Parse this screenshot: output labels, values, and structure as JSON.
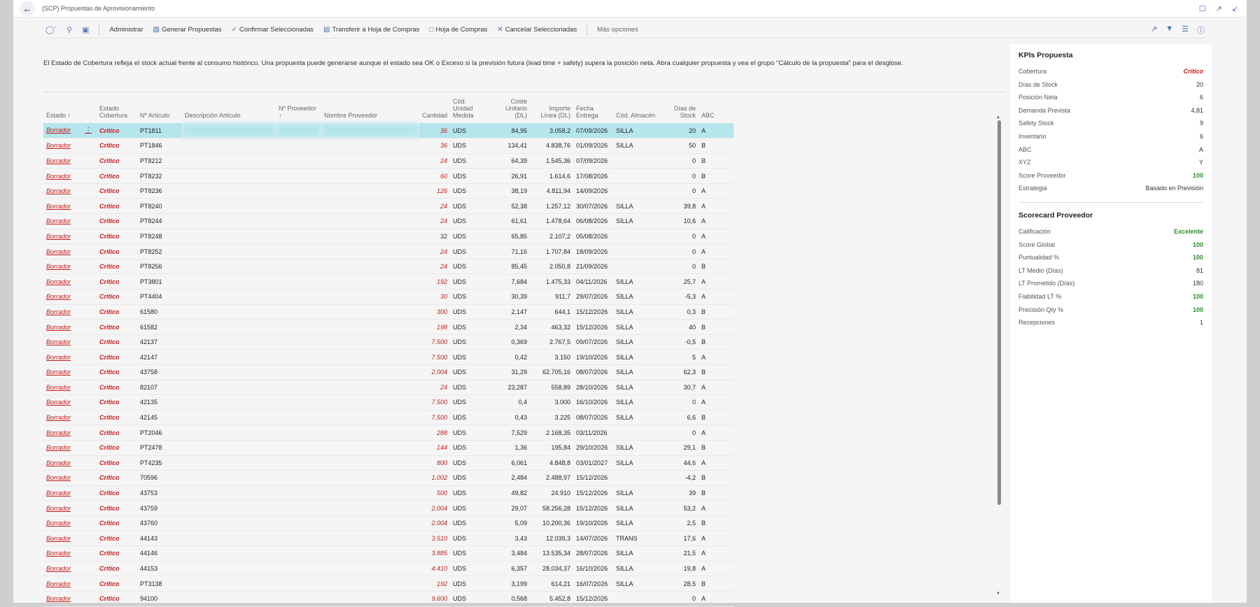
{
  "window": {
    "title": "(SCP) Propuestas de Aprovisionamiento"
  },
  "toolbar": {
    "items": [
      {
        "label": "Administrar",
        "icon": ""
      },
      {
        "label": "Generar Propuestas",
        "icon": "generate-icon"
      },
      {
        "label": "Confirmar Seleccionadas",
        "icon": "check-icon"
      },
      {
        "label": "Transferir a Hoja de Compras",
        "icon": "transfer-icon"
      },
      {
        "label": "Hoja de Compras",
        "icon": "document-icon"
      },
      {
        "label": "Cancelar Seleccionadas",
        "icon": "close-icon"
      }
    ],
    "more": "Más opciones"
  },
  "info_text": "El Estado de Cobertura refleja el stock actual frente al consumo histórico. Una propuesta puede generarse aunque el estado sea OK o Exceso si la previsión futura (lead time + safety) supera la posición neta. Abra cualquier propuesta y vea el grupo \"Cálculo de la propuesta\" para el desglose.",
  "columns": {
    "estado": "Estado ↑",
    "cobertura": "Estado Cobertura",
    "articulo": "Nº Artículo",
    "descripcion": "Descripción Artículo",
    "proveedor": "Nº Proveedor ↑",
    "nombre": "Nombre Proveedor",
    "cantidad": "Cantidad",
    "unidad": "Cód. Unidad Medida",
    "coste": "Coste Unitario (DL)",
    "importe": "Importe Línea (DL)",
    "fecha": "Fecha Entrega",
    "almacen": "Cód. Almacén",
    "dias": "Días de Stock",
    "abc": "ABC"
  },
  "rows": [
    {
      "estado": "Borrador",
      "cob": "Crítico",
      "art": "PT1811",
      "qty": "36",
      "red": true,
      "ud": "UDS",
      "coste": "84,95",
      "imp": "3.058,2",
      "fecha": "07/09/2026",
      "alm": "SILLA",
      "dias": "20",
      "abc": "A"
    },
    {
      "estado": "Borrador",
      "cob": "Crítico",
      "art": "PT1846",
      "qty": "36",
      "red": true,
      "ud": "UDS",
      "coste": "134,41",
      "imp": "4.838,76",
      "fecha": "01/09/2026",
      "alm": "SILLA",
      "dias": "50",
      "abc": "B"
    },
    {
      "estado": "Borrador",
      "cob": "Crítico",
      "art": "PT8212",
      "qty": "24",
      "red": true,
      "ud": "UDS",
      "coste": "64,39",
      "imp": "1.545,36",
      "fecha": "07/09/2026",
      "alm": "",
      "dias": "0",
      "abc": "B"
    },
    {
      "estado": "Borrador",
      "cob": "Crítico",
      "art": "PT8232",
      "qty": "60",
      "red": true,
      "ud": "UDS",
      "coste": "26,91",
      "imp": "1.614,6",
      "fecha": "17/08/2026",
      "alm": "",
      "dias": "0",
      "abc": "B"
    },
    {
      "estado": "Borrador",
      "cob": "Crítico",
      "art": "PT8236",
      "qty": "126",
      "red": true,
      "ud": "UDS",
      "coste": "38,19",
      "imp": "4.811,94",
      "fecha": "14/09/2026",
      "alm": "",
      "dias": "0",
      "abc": "A"
    },
    {
      "estado": "Borrador",
      "cob": "Crítico",
      "art": "PT8240",
      "qty": "24",
      "red": true,
      "ud": "UDS",
      "coste": "52,38",
      "imp": "1.257,12",
      "fecha": "30/07/2026",
      "alm": "SILLA",
      "dias": "39,8",
      "abc": "A"
    },
    {
      "estado": "Borrador",
      "cob": "Crítico",
      "art": "PT8244",
      "qty": "24",
      "red": true,
      "ud": "UDS",
      "coste": "61,61",
      "imp": "1.478,64",
      "fecha": "06/08/2026",
      "alm": "SILLA",
      "dias": "10,6",
      "abc": "A"
    },
    {
      "estado": "Borrador",
      "cob": "Crítico",
      "art": "PT8248",
      "qty": "32",
      "red": false,
      "ud": "UDS",
      "coste": "65,85",
      "imp": "2.107,2",
      "fecha": "05/08/2026",
      "alm": "",
      "dias": "0",
      "abc": "A"
    },
    {
      "estado": "Borrador",
      "cob": "Crítico",
      "art": "PT8252",
      "qty": "24",
      "red": true,
      "ud": "UDS",
      "coste": "71,16",
      "imp": "1.707,84",
      "fecha": "18/09/2026",
      "alm": "",
      "dias": "0",
      "abc": "A"
    },
    {
      "estado": "Borrador",
      "cob": "Crítico",
      "art": "PT8256",
      "qty": "24",
      "red": true,
      "ud": "UDS",
      "coste": "85,45",
      "imp": "2.050,8",
      "fecha": "21/09/2026",
      "alm": "",
      "dias": "0",
      "abc": "B"
    },
    {
      "estado": "Borrador",
      "cob": "Crítico",
      "art": "PT3801",
      "qty": "192",
      "red": true,
      "ud": "UDS",
      "coste": "7,684",
      "imp": "1.475,33",
      "fecha": "04/11/2026",
      "alm": "SILLA",
      "dias": "25,7",
      "abc": "A"
    },
    {
      "estado": "Borrador",
      "cob": "Crítico",
      "art": "PT4404",
      "qty": "30",
      "red": true,
      "ud": "UDS",
      "coste": "30,39",
      "imp": "911,7",
      "fecha": "29/07/2026",
      "alm": "SILLA",
      "dias": "-5,3",
      "abc": "A"
    },
    {
      "estado": "Borrador",
      "cob": "Crítico",
      "art": "61580",
      "qty": "300",
      "red": true,
      "ud": "UDS",
      "coste": "2,147",
      "imp": "644,1",
      "fecha": "15/12/2026",
      "alm": "SILLA",
      "dias": "0,3",
      "abc": "B"
    },
    {
      "estado": "Borrador",
      "cob": "Crítico",
      "art": "61582",
      "qty": "198",
      "red": true,
      "ud": "UDS",
      "coste": "2,34",
      "imp": "463,32",
      "fecha": "15/12/2026",
      "alm": "SILLA",
      "dias": "40",
      "abc": "B"
    },
    {
      "estado": "Borrador",
      "cob": "Crítico",
      "art": "42137",
      "qty": "7.500",
      "red": true,
      "ud": "UDS",
      "coste": "0,369",
      "imp": "2.767,5",
      "fecha": "09/07/2026",
      "alm": "SILLA",
      "dias": "-0,5",
      "abc": "B"
    },
    {
      "estado": "Borrador",
      "cob": "Crítico",
      "art": "42147",
      "qty": "7.500",
      "red": true,
      "ud": "UDS",
      "coste": "0,42",
      "imp": "3.150",
      "fecha": "19/10/2026",
      "alm": "SILLA",
      "dias": "5",
      "abc": "A"
    },
    {
      "estado": "Borrador",
      "cob": "Crítico",
      "art": "43758",
      "qty": "2.004",
      "red": true,
      "ud": "UDS",
      "coste": "31,29",
      "imp": "62.705,16",
      "fecha": "08/07/2026",
      "alm": "SILLA",
      "dias": "62,3",
      "abc": "B"
    },
    {
      "estado": "Borrador",
      "cob": "Crítico",
      "art": "82107",
      "qty": "24",
      "red": true,
      "ud": "UDS",
      "coste": "23,287",
      "imp": "558,89",
      "fecha": "28/10/2026",
      "alm": "SILLA",
      "dias": "30,7",
      "abc": "A"
    },
    {
      "estado": "Borrador",
      "cob": "Crítico",
      "art": "42135",
      "qty": "7.500",
      "red": true,
      "ud": "UDS",
      "coste": "0,4",
      "imp": "3.000",
      "fecha": "16/10/2026",
      "alm": "SILLA",
      "dias": "0",
      "abc": "A"
    },
    {
      "estado": "Borrador",
      "cob": "Crítico",
      "art": "42145",
      "qty": "7.500",
      "red": true,
      "ud": "UDS",
      "coste": "0,43",
      "imp": "3.225",
      "fecha": "08/07/2026",
      "alm": "SILLA",
      "dias": "6,6",
      "abc": "B"
    },
    {
      "estado": "Borrador",
      "cob": "Crítico",
      "art": "PT2046",
      "qty": "288",
      "red": true,
      "ud": "UDS",
      "coste": "7,529",
      "imp": "2.168,35",
      "fecha": "03/11/2026",
      "alm": "",
      "dias": "0",
      "abc": "A"
    },
    {
      "estado": "Borrador",
      "cob": "Crítico",
      "art": "PT2478",
      "qty": "144",
      "red": true,
      "ud": "UDS",
      "coste": "1,36",
      "imp": "195,84",
      "fecha": "29/10/2026",
      "alm": "SILLA",
      "dias": "29,1",
      "abc": "B"
    },
    {
      "estado": "Borrador",
      "cob": "Crítico",
      "art": "PT4235",
      "qty": "800",
      "red": true,
      "ud": "UDS",
      "coste": "6,061",
      "imp": "4.848,8",
      "fecha": "03/01/2027",
      "alm": "SILLA",
      "dias": "44,6",
      "abc": "A"
    },
    {
      "estado": "Borrador",
      "cob": "Crítico",
      "art": "70596",
      "qty": "1.002",
      "red": true,
      "ud": "UDS",
      "coste": "2,484",
      "imp": "2.488,97",
      "fecha": "15/12/2026",
      "alm": "",
      "dias": "-4,2",
      "abc": "B"
    },
    {
      "estado": "Borrador",
      "cob": "Crítico",
      "art": "43753",
      "qty": "500",
      "red": true,
      "ud": "UDS",
      "coste": "49,82",
      "imp": "24.910",
      "fecha": "15/12/2026",
      "alm": "SILLA",
      "dias": "39",
      "abc": "B"
    },
    {
      "estado": "Borrador",
      "cob": "Crítico",
      "art": "43759",
      "qty": "2.004",
      "red": true,
      "ud": "UDS",
      "coste": "29,07",
      "imp": "58.256,28",
      "fecha": "15/12/2026",
      "alm": "SILLA",
      "dias": "53,2",
      "abc": "A"
    },
    {
      "estado": "Borrador",
      "cob": "Crítico",
      "art": "43760",
      "qty": "2.004",
      "red": true,
      "ud": "UDS",
      "coste": "5,09",
      "imp": "10.200,36",
      "fecha": "19/10/2026",
      "alm": "SILLA",
      "dias": "2,5",
      "abc": "B"
    },
    {
      "estado": "Borrador",
      "cob": "Crítico",
      "art": "44143",
      "qty": "3.510",
      "red": true,
      "ud": "UDS",
      "coste": "3,43",
      "imp": "12.039,3",
      "fecha": "14/07/2026",
      "alm": "TRANS",
      "dias": "17,6",
      "abc": "A"
    },
    {
      "estado": "Borrador",
      "cob": "Crítico",
      "art": "44146",
      "qty": "3.885",
      "red": true,
      "ud": "UDS",
      "coste": "3,484",
      "imp": "13.535,34",
      "fecha": "28/07/2026",
      "alm": "SILLA",
      "dias": "21,5",
      "abc": "A"
    },
    {
      "estado": "Borrador",
      "cob": "Crítico",
      "art": "44153",
      "qty": "4.410",
      "red": true,
      "ud": "UDS",
      "coste": "6,357",
      "imp": "28.034,37",
      "fecha": "16/10/2026",
      "alm": "SILLA",
      "dias": "19,8",
      "abc": "A"
    },
    {
      "estado": "Borrador",
      "cob": "Crítico",
      "art": "PT3138",
      "qty": "192",
      "red": true,
      "ud": "UDS",
      "coste": "3,199",
      "imp": "614,21",
      "fecha": "16/07/2026",
      "alm": "SILLA",
      "dias": "28,5",
      "abc": "B"
    },
    {
      "estado": "Borrador",
      "cob": "Crítico",
      "art": "94100",
      "qty": "9.600",
      "red": true,
      "ud": "UDS",
      "coste": "0,568",
      "imp": "5.452,8",
      "fecha": "15/12/2026",
      "alm": "",
      "dias": "0",
      "abc": "A"
    }
  ],
  "kpis": {
    "title": "KPIs Propuesta",
    "items": [
      {
        "label": "Cobertura",
        "value": "Crítico",
        "style": "crit"
      },
      {
        "label": "Días de Stock",
        "value": "20",
        "style": ""
      },
      {
        "label": "Posición Neta",
        "value": "6",
        "style": ""
      },
      {
        "label": "Demanda Prevista",
        "value": "4,81",
        "style": ""
      },
      {
        "label": "Safety Stock",
        "value": "9",
        "style": ""
      },
      {
        "label": "Inventario",
        "value": "6",
        "style": ""
      },
      {
        "label": "ABC",
        "value": "A",
        "style": ""
      },
      {
        "label": "XYZ",
        "value": "Y",
        "style": ""
      },
      {
        "label": "Score Proveedor",
        "value": "100",
        "style": "good"
      },
      {
        "label": "Estrategia",
        "value": "Basado en Previsión",
        "style": ""
      }
    ]
  },
  "scorecard": {
    "title": "Scorecard Proveedor",
    "items": [
      {
        "label": "Calificación",
        "value": "Excelente",
        "style": "good"
      },
      {
        "label": "Score Global",
        "value": "100",
        "style": "good"
      },
      {
        "label": "Puntualidad %",
        "value": "100",
        "style": "good"
      },
      {
        "label": "LT Medio (Días)",
        "value": "81",
        "style": ""
      },
      {
        "label": "LT Prometido (Días)",
        "value": "180",
        "style": ""
      },
      {
        "label": "Fiabilidad LT %",
        "value": "100",
        "style": "good"
      },
      {
        "label": "Precisión Qty %",
        "value": "100",
        "style": "good"
      },
      {
        "label": "Recepciones",
        "value": "1",
        "style": ""
      }
    ]
  },
  "colors": {
    "critical": "#c21d1d",
    "good": "#2e8b2e",
    "selected_row": "#b5e6ec",
    "accent": "#4a6fb0"
  }
}
